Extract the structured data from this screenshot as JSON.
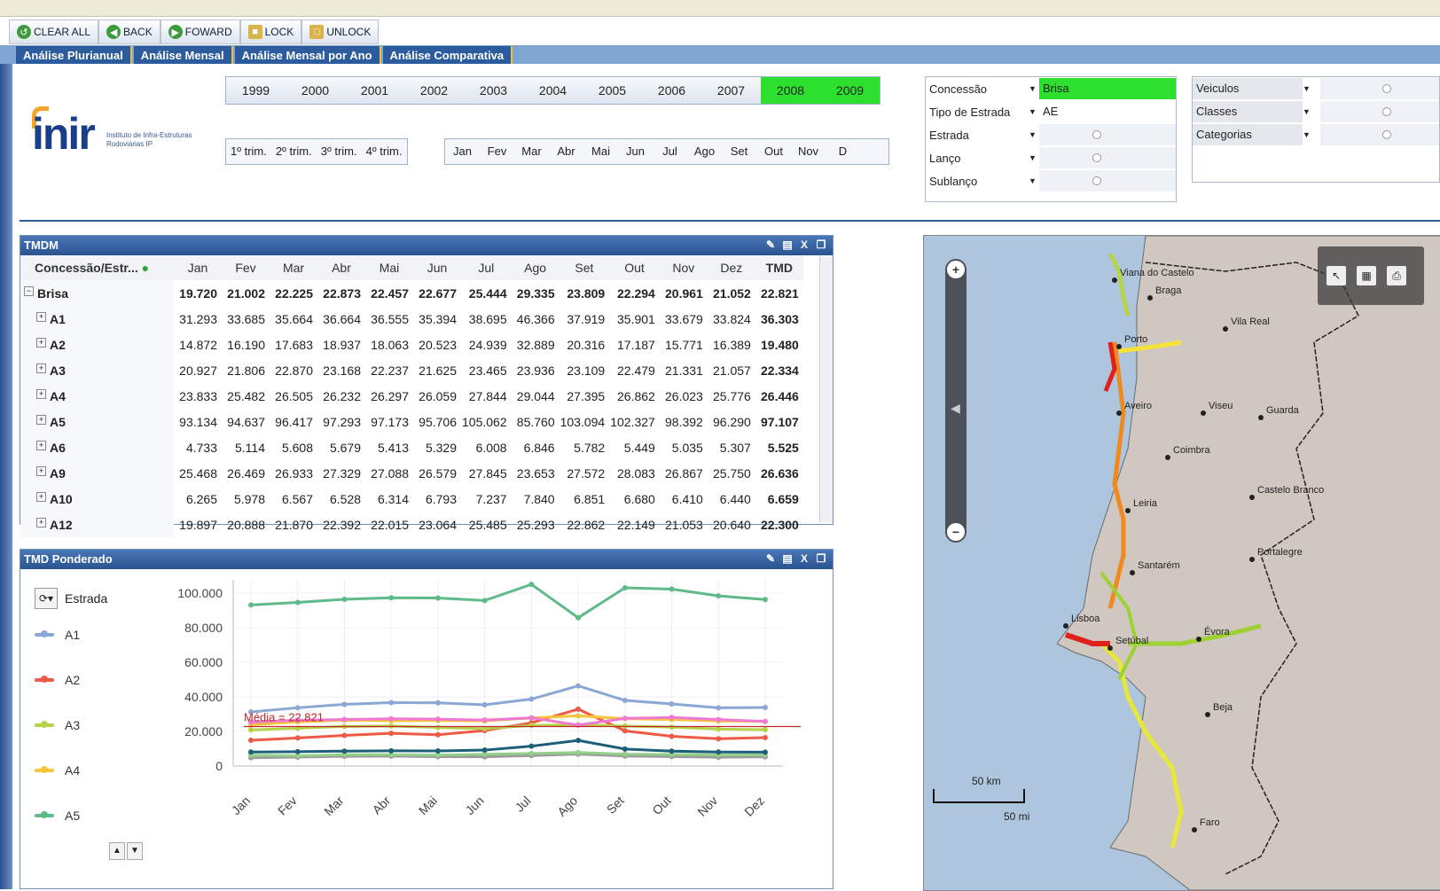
{
  "toolbar": {
    "clear_all": "CLEAR ALL",
    "back": "BACK",
    "forward": "FOWARD",
    "lock": "LOCK",
    "unlock": "UNLOCK"
  },
  "tabs": [
    "Análise Plurianual",
    "Análise Mensal",
    "Análise Mensal por Ano",
    "Análise Comparativa"
  ],
  "logo": {
    "text": "inir",
    "subtitle": "Instituto de Infra-Estruturas Rodoviárias IP"
  },
  "years": [
    "1999",
    "2000",
    "2001",
    "2002",
    "2003",
    "2004",
    "2005",
    "2006",
    "2007",
    "2008",
    "2009"
  ],
  "selected_years": [
    "2008",
    "2009"
  ],
  "trimesters": [
    "1º trim.",
    "2º trim.",
    "3º trim.",
    "4º trim."
  ],
  "months": [
    "Jan",
    "Fev",
    "Mar",
    "Abr",
    "Mai",
    "Jun",
    "Jul",
    "Ago",
    "Set",
    "Out",
    "Nov",
    "D"
  ],
  "filters": {
    "concessao": {
      "label": "Concessão",
      "value": "Brisa"
    },
    "tipo_estrada": {
      "label": "Tipo de Estrada",
      "value": "AE"
    },
    "estrada": {
      "label": "Estrada",
      "value": ""
    },
    "lanco": {
      "label": "Lanço",
      "value": ""
    },
    "sublanco": {
      "label": "Sublanço",
      "value": ""
    }
  },
  "vfilters": {
    "veiculos": "Veiculos",
    "classes": "Classes",
    "categorias": "Categorias"
  },
  "tmdm": {
    "title": "TMDM",
    "columns": [
      "Concessão/Estr...",
      "Jan",
      "Fev",
      "Mar",
      "Abr",
      "Mai",
      "Jun",
      "Jul",
      "Ago",
      "Set",
      "Out",
      "Nov",
      "Dez",
      "TMD"
    ],
    "rows": [
      {
        "name": "Brisa",
        "values": [
          "19.720",
          "21.002",
          "22.225",
          "22.873",
          "22.457",
          "22.677",
          "25.444",
          "29.335",
          "23.809",
          "22.294",
          "20.961",
          "21.052",
          "22.821"
        ]
      },
      {
        "name": "A1",
        "values": [
          "31.293",
          "33.685",
          "35.664",
          "36.664",
          "36.555",
          "35.394",
          "38.695",
          "46.366",
          "37.919",
          "35.901",
          "33.679",
          "33.824",
          "36.303"
        ]
      },
      {
        "name": "A2",
        "values": [
          "14.872",
          "16.190",
          "17.683",
          "18.937",
          "18.063",
          "20.523",
          "24.939",
          "32.889",
          "20.316",
          "17.187",
          "15.771",
          "16.389",
          "19.480"
        ]
      },
      {
        "name": "A3",
        "values": [
          "20.927",
          "21.806",
          "22.870",
          "23.168",
          "22.237",
          "21.625",
          "23.465",
          "23.936",
          "23.109",
          "22.479",
          "21.331",
          "21.057",
          "22.334"
        ]
      },
      {
        "name": "A4",
        "values": [
          "23.833",
          "25.482",
          "26.505",
          "26.232",
          "26.297",
          "26.059",
          "27.844",
          "29.044",
          "27.395",
          "26.862",
          "26.023",
          "25.776",
          "26.446"
        ]
      },
      {
        "name": "A5",
        "values": [
          "93.134",
          "94.637",
          "96.417",
          "97.293",
          "97.173",
          "95.706",
          "105.062",
          "85.760",
          "103.094",
          "102.327",
          "98.392",
          "96.290",
          "97.107"
        ]
      },
      {
        "name": "A6",
        "values": [
          "4.733",
          "5.114",
          "5.608",
          "5.679",
          "5.413",
          "5.329",
          "6.008",
          "6.846",
          "5.782",
          "5.449",
          "5.035",
          "5.307",
          "5.525"
        ]
      },
      {
        "name": "A9",
        "values": [
          "25.468",
          "26.469",
          "26.933",
          "27.329",
          "27.088",
          "26.579",
          "27.845",
          "23.653",
          "27.572",
          "28.083",
          "26.867",
          "25.750",
          "26.636"
        ]
      },
      {
        "name": "A10",
        "values": [
          "6.265",
          "5.978",
          "6.567",
          "6.528",
          "6.314",
          "6.793",
          "7.237",
          "7.840",
          "6.851",
          "6.680",
          "6.410",
          "6.440",
          "6.659"
        ]
      },
      {
        "name": "A12",
        "values": [
          "19.897",
          "20.888",
          "21.870",
          "22.392",
          "22.015",
          "23.064",
          "25.485",
          "25.293",
          "22.862",
          "22.149",
          "21.053",
          "20.640",
          "22.300"
        ]
      }
    ]
  },
  "tmdp": {
    "title": "TMD Ponderado",
    "legend_title": "Estrada",
    "media_label": "Média = 22.821"
  },
  "chart_data": {
    "type": "line",
    "title": "TMD Ponderado",
    "categories": [
      "Jan",
      "Fev",
      "Mar",
      "Abr",
      "Mai",
      "Jun",
      "Jul",
      "Ago",
      "Set",
      "Out",
      "Nov",
      "Dez"
    ],
    "ylim": [
      0,
      100000
    ],
    "yticks": [
      "100.000",
      "80.000",
      "60.000",
      "40.000",
      "20.000",
      "0"
    ],
    "reference_line": {
      "label": "Média = 22.821",
      "value": 22821,
      "color": "#c0282a"
    },
    "series": [
      {
        "name": "A1",
        "color": "#8aa7d6",
        "values": [
          31293,
          33685,
          35664,
          36664,
          36555,
          35394,
          38695,
          46366,
          37919,
          35901,
          33679,
          33824
        ]
      },
      {
        "name": "A2",
        "color": "#ef5a47",
        "values": [
          14872,
          16190,
          17683,
          18937,
          18063,
          20523,
          24939,
          32889,
          20316,
          17187,
          15771,
          16389
        ]
      },
      {
        "name": "A3",
        "color": "#b6d44a",
        "values": [
          20927,
          21806,
          22870,
          23168,
          22237,
          21625,
          23465,
          23936,
          23109,
          22479,
          21331,
          21057
        ]
      },
      {
        "name": "A4",
        "color": "#f5c53a",
        "values": [
          23833,
          25482,
          26505,
          26232,
          26297,
          26059,
          27844,
          29044,
          27395,
          26862,
          26023,
          25776
        ]
      },
      {
        "name": "A5",
        "color": "#5fba8a",
        "values": [
          93134,
          94637,
          96417,
          97293,
          97173,
          95706,
          105062,
          85760,
          103094,
          102327,
          98392,
          96290
        ]
      },
      {
        "color": "#9b9b9b",
        "values": [
          4733,
          5114,
          5608,
          5679,
          5413,
          5329,
          6008,
          6846,
          5782,
          5449,
          5035,
          5307
        ]
      },
      {
        "color": "#f07ad0",
        "values": [
          25468,
          26469,
          26933,
          27329,
          27088,
          26579,
          27845,
          23653,
          27572,
          28083,
          26867,
          25750
        ]
      },
      {
        "color": "#93d08a",
        "values": [
          6265,
          5978,
          6567,
          6528,
          6314,
          6793,
          7237,
          7840,
          6851,
          6680,
          6410,
          6440
        ]
      },
      {
        "color": "#1d5f7a",
        "values": [
          8100,
          8300,
          8600,
          8800,
          8700,
          9200,
          11500,
          14800,
          9800,
          8600,
          8100,
          8000
        ]
      }
    ]
  },
  "legend_visible": [
    "A1",
    "A2",
    "A3",
    "A4",
    "A5"
  ],
  "map": {
    "cities": [
      "Viana do Castelo",
      "Braga",
      "Vila Real",
      "Porto",
      "Viseu",
      "Guarda",
      "Aveiro",
      "Coimbra",
      "Castelo Branco",
      "Leiria",
      "Santarém",
      "Portalegre",
      "Lisboa",
      "Setúbal",
      "Évora",
      "Beja",
      "Faro"
    ],
    "scale_km": "50 km",
    "scale_mi": "50 mi"
  }
}
